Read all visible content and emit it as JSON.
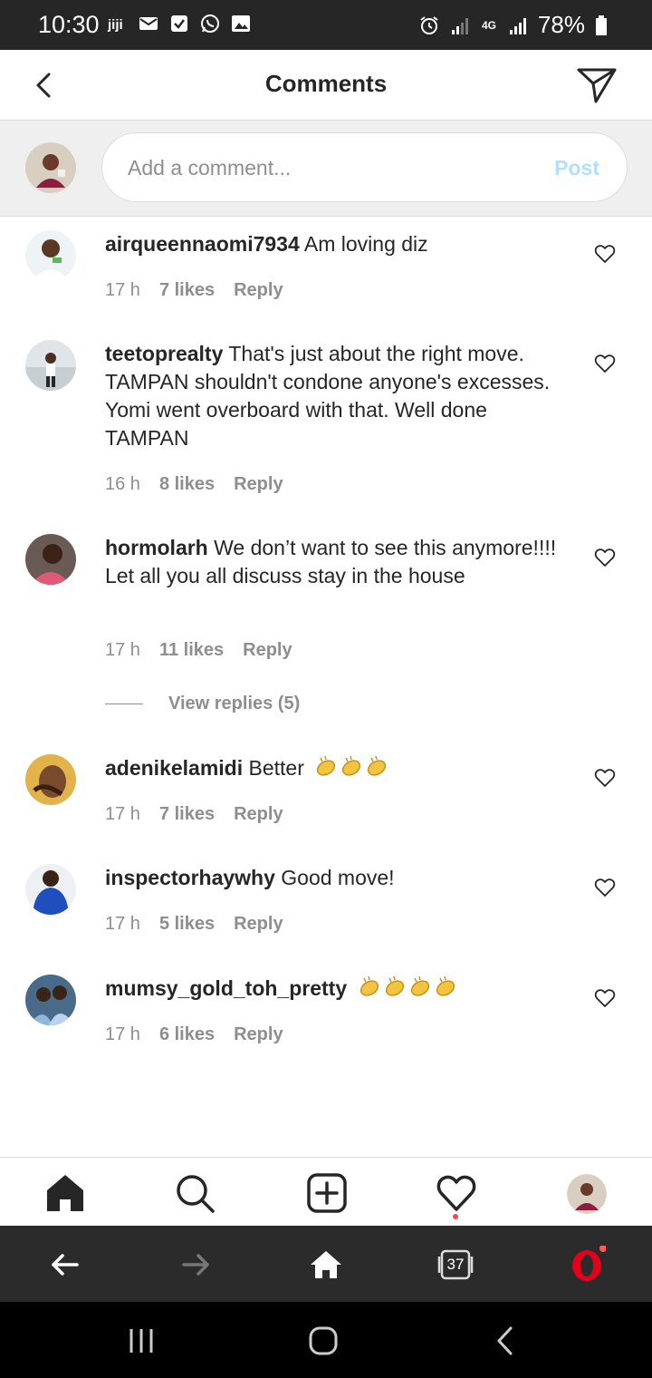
{
  "status_bar": {
    "time": "10:30",
    "network": "4G",
    "battery": "78%"
  },
  "header": {
    "title": "Comments"
  },
  "comment_input": {
    "placeholder": "Add a comment...",
    "post_label": "Post"
  },
  "comments": [
    {
      "username": "airqueennaomi7934",
      "text": " Am loving diz",
      "time": "17 h",
      "likes": "7 likes",
      "reply": "Reply"
    },
    {
      "username": "teetoprealty",
      "text": " That's just about the right move. TAMPAN shouldn't condone anyone's excesses. Yomi went overboard with that. Well done TAMPAN",
      "time": "16 h",
      "likes": "8 likes",
      "reply": "Reply"
    },
    {
      "username": "hormolarh",
      "text": " We don’t want to see this anymore!!!! Let all you all discuss stay in the house",
      "time": "17 h",
      "likes": "11 likes",
      "reply": "Reply"
    },
    {
      "username": "adenikelamidi",
      "text": " Better",
      "time": "17 h",
      "likes": "7 likes",
      "reply": "Reply"
    },
    {
      "username": "inspectorhaywhy",
      "text": " Good move!",
      "time": "17 h",
      "likes": "5 likes",
      "reply": "Reply"
    },
    {
      "username": "mumsy_gold_toh_pretty",
      "text": "",
      "time": "17 h",
      "likes": "6 likes",
      "reply": "Reply"
    }
  ],
  "view_replies": "View replies (5)",
  "browser_bar": {
    "tabs_count": "37"
  },
  "colors": {
    "text": "#262626",
    "muted": "#8e8e8e",
    "post_disabled": "#b2dffc",
    "notification_dot": "#ed4956",
    "opera_red": "#e3001b"
  }
}
